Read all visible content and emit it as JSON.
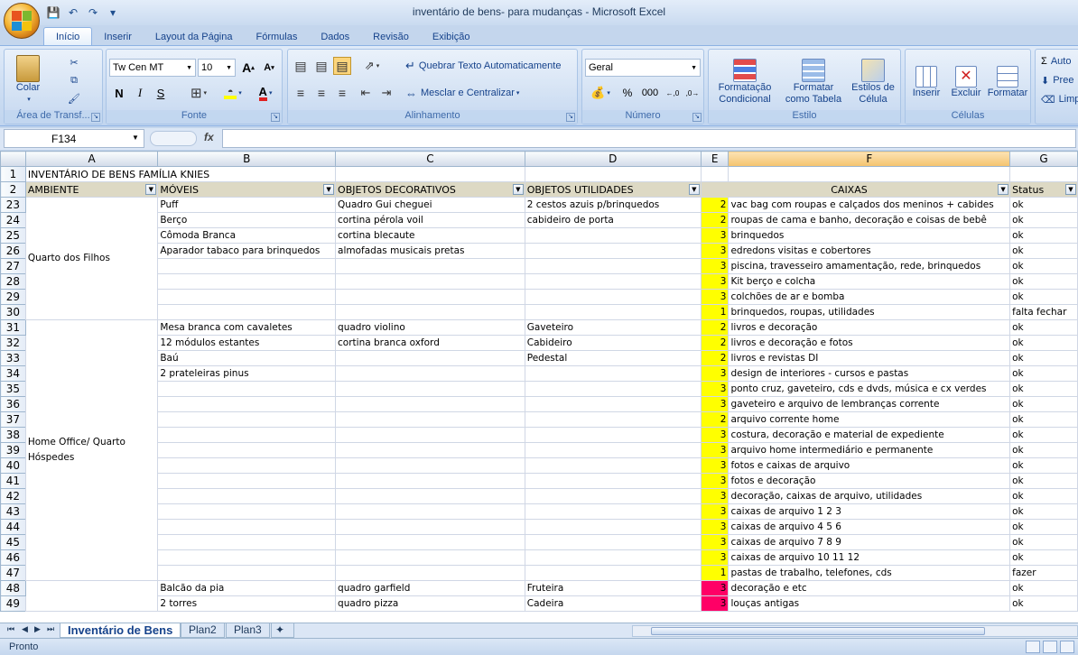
{
  "window": {
    "title": "inventário de bens- para mudanças - Microsoft Excel"
  },
  "tabs": [
    "Início",
    "Inserir",
    "Layout da Página",
    "Fórmulas",
    "Dados",
    "Revisão",
    "Exibição"
  ],
  "ribbon": {
    "clipboard": {
      "paste": "Colar",
      "label": "Área de Transf..."
    },
    "font": {
      "name": "Tw Cen MT",
      "size": "10",
      "bold": "N",
      "italic": "I",
      "underline": "S",
      "label": "Fonte"
    },
    "alignment": {
      "wrap": "Quebrar Texto Automaticamente",
      "merge": "Mesclar e Centralizar",
      "label": "Alinhamento"
    },
    "number": {
      "format": "Geral",
      "percent": "%",
      "thousands": "000",
      "label": "Número"
    },
    "styles": {
      "cond": "Formatação Condicional",
      "table": "Formatar como Tabela",
      "cell": "Estilos de Célula",
      "label": "Estilo"
    },
    "cells": {
      "insert": "Inserir",
      "delete": "Excluir",
      "format": "Formatar",
      "label": "Células"
    },
    "editing": {
      "autosum": "Auto",
      "fill": "Pree",
      "clear": "Limp"
    }
  },
  "formula_bar": {
    "name_box": "F134",
    "fx": "fx",
    "formula": ""
  },
  "columns": [
    "A",
    "B",
    "C",
    "D",
    "E",
    "F",
    "G"
  ],
  "title_row": {
    "num": "1",
    "text": "INVENTÁRIO DE BENS FAMÍLIA KNIES"
  },
  "header_row": {
    "num": "2",
    "ambiente": "AMBIENTE",
    "moveis": "MÓVEIS",
    "decorativos": "OBJETOS DECORATIVOS",
    "utilidades": "OBJETOS UTILIDADES",
    "caixas": "CAIXAS",
    "status": "Status"
  },
  "groups": [
    {
      "ambiente": "Quarto dos Filhos",
      "rows": [
        {
          "num": "23",
          "b": "Puff",
          "c": "Quadro Gui cheguei",
          "d": "2 cestos azuis p/brinquedos",
          "e": "2",
          "f": "vac bag com roupas e calçados dos meninos + cabides",
          "g": "ok"
        },
        {
          "num": "24",
          "b": "Berço",
          "c": "cortina pérola voil",
          "d": "cabideiro de porta",
          "e": "2",
          "f": "roupas de cama e banho, decoração e coisas de bebê",
          "g": "ok"
        },
        {
          "num": "25",
          "b": "Cômoda Branca",
          "c": "cortina blecaute",
          "d": "",
          "e": "3",
          "f": "brinquedos",
          "g": "ok"
        },
        {
          "num": "26",
          "b": "Aparador tabaco para brinquedos",
          "c": "almofadas musicais pretas",
          "d": "",
          "e": "3",
          "f": "edredons visitas e cobertores",
          "g": "ok"
        },
        {
          "num": "27",
          "b": "",
          "c": "",
          "d": "",
          "e": "3",
          "f": "piscina, travesseiro amamentação, rede, brinquedos",
          "g": "ok"
        },
        {
          "num": "28",
          "b": "",
          "c": "",
          "d": "",
          "e": "3",
          "f": "Kit berço e colcha",
          "g": "ok"
        },
        {
          "num": "29",
          "b": "",
          "c": "",
          "d": "",
          "e": "3",
          "f": "colchões de ar e bomba",
          "g": "ok"
        },
        {
          "num": "30",
          "b": "",
          "c": "",
          "d": "",
          "e": "1",
          "f": "brinquedos, roupas, utilidades",
          "g": "falta fechar"
        }
      ]
    },
    {
      "ambiente": "Home Office/ Quarto Hóspedes",
      "rows": [
        {
          "num": "31",
          "b": "Mesa branca com cavaletes",
          "c": "quadro violino",
          "d": "Gaveteiro",
          "e": "2",
          "f": "livros e decoração",
          "g": "ok"
        },
        {
          "num": "32",
          "b": "12 módulos estantes",
          "c": "cortina branca oxford",
          "d": "Cabideiro",
          "e": "2",
          "f": "livros e decoração e fotos",
          "g": "ok"
        },
        {
          "num": "33",
          "b": "Baú",
          "c": "",
          "d": "Pedestal",
          "e": "2",
          "f": "livros e revistas DI",
          "g": "ok"
        },
        {
          "num": "34",
          "b": "2 prateleiras pinus",
          "c": "",
          "d": "",
          "e": "3",
          "f": "design de interiores - cursos e pastas",
          "g": "ok"
        },
        {
          "num": "35",
          "b": "",
          "c": "",
          "d": "",
          "e": "3",
          "f": "ponto cruz, gaveteiro, cds e dvds, música e cx verdes",
          "g": "ok"
        },
        {
          "num": "36",
          "b": "",
          "c": "",
          "d": "",
          "e": "3",
          "f": "gaveteiro e arquivo de lembranças corrente",
          "g": "ok"
        },
        {
          "num": "37",
          "b": "",
          "c": "",
          "d": "",
          "e": "2",
          "f": "arquivo corrente home",
          "g": "ok"
        },
        {
          "num": "38",
          "b": "",
          "c": "",
          "d": "",
          "e": "3",
          "f": "costura, decoração e material de expediente",
          "g": "ok"
        },
        {
          "num": "39",
          "b": "",
          "c": "",
          "d": "",
          "e": "3",
          "f": "arquivo home intermediário e permanente",
          "g": "ok"
        },
        {
          "num": "40",
          "b": "",
          "c": "",
          "d": "",
          "e": "3",
          "f": "fotos e caixas de arquivo",
          "g": "ok"
        },
        {
          "num": "41",
          "b": "",
          "c": "",
          "d": "",
          "e": "3",
          "f": "fotos e decoração",
          "g": "ok"
        },
        {
          "num": "42",
          "b": "",
          "c": "",
          "d": "",
          "e": "3",
          "f": "decoração, caixas de arquivo, utilidades",
          "g": "ok"
        },
        {
          "num": "43",
          "b": "",
          "c": "",
          "d": "",
          "e": "3",
          "f": "caixas de arquivo 1 2 3",
          "g": "ok"
        },
        {
          "num": "44",
          "b": "",
          "c": "",
          "d": "",
          "e": "3",
          "f": "caixas de arquivo 4 5 6",
          "g": "ok"
        },
        {
          "num": "45",
          "b": "",
          "c": "",
          "d": "",
          "e": "3",
          "f": "caixas de arquivo 7 8 9",
          "g": "ok"
        },
        {
          "num": "46",
          "b": "",
          "c": "",
          "d": "",
          "e": "3",
          "f": "caixas de arquivo 10 11 12",
          "g": "ok"
        },
        {
          "num": "47",
          "b": "",
          "c": "",
          "d": "",
          "e": "1",
          "f": "pastas de trabalho, telefones, cds",
          "g": "fazer"
        }
      ]
    },
    {
      "ambiente": "",
      "rows": [
        {
          "num": "48",
          "b": "Balcão da pia",
          "c": "quadro garfield",
          "d": "Fruteira",
          "e": "3",
          "f": "decoração e etc",
          "g": "ok",
          "mag": true
        },
        {
          "num": "49",
          "b": "2 torres",
          "c": "quadro pizza",
          "d": "Cadeira",
          "e": "3",
          "f": "louças antigas",
          "g": "ok",
          "mag": true
        }
      ]
    }
  ],
  "sheets": [
    "Inventário de Bens",
    "Plan2",
    "Plan3"
  ],
  "status": "Pronto",
  "colors": {
    "yellow": "#ffff00",
    "magenta": "#ff0066",
    "header": "#ddd9c4"
  }
}
